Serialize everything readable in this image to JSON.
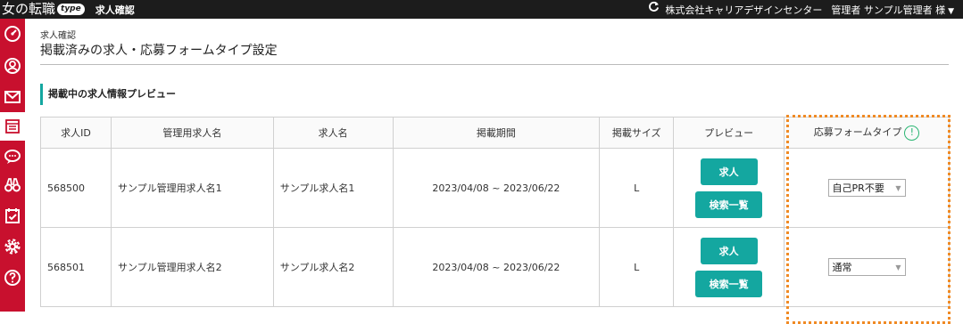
{
  "topbar": {
    "logo_text": "女の転職",
    "logo_badge": "type",
    "page_label": "求人確認",
    "company": "株式会社キャリアデザインセンター",
    "user": "管理者 サンプル管理者 様",
    "refresh_icon": "refresh-icon",
    "caret": "▼"
  },
  "sidebar": {
    "icons": [
      "dashboard-icon",
      "user-circle-icon",
      "mail-icon",
      "document-list-icon",
      "chat-bubble-icon",
      "binoculars-icon",
      "calendar-check-icon",
      "gear-icon",
      "help-circle-icon"
    ]
  },
  "header": {
    "breadcrumb": "求人確認",
    "title": "掲載済みの求人・応募フォームタイプ設定"
  },
  "section": {
    "title": "掲載中の求人情報プレビュー"
  },
  "table": {
    "headers": [
      "求人ID",
      "管理用求人名",
      "求人名",
      "掲載期間",
      "掲載サイズ",
      "プレビュー",
      "応募フォームタイプ"
    ],
    "info_icon_label": "!",
    "rows": [
      {
        "id": "568500",
        "admin_name": "サンプル管理用求人名1",
        "job_name": "サンプル求人名1",
        "period": "2023/04/08 ~ 2023/06/22",
        "size": "L",
        "btn_job": "求人",
        "btn_list": "検索一覧",
        "form_type": "自己PR不要"
      },
      {
        "id": "568501",
        "admin_name": "サンプル管理用求人名2",
        "job_name": "サンプル求人名2",
        "period": "2023/04/08 ~ 2023/06/22",
        "size": "L",
        "btn_job": "求人",
        "btn_list": "検索一覧",
        "form_type": "通常"
      }
    ]
  },
  "colors": {
    "topbar": "#1c1c1c",
    "sidebar": "#c8102e",
    "accent": "#14a7a0",
    "highlight": "#f08a24",
    "info": "#2bb673"
  }
}
